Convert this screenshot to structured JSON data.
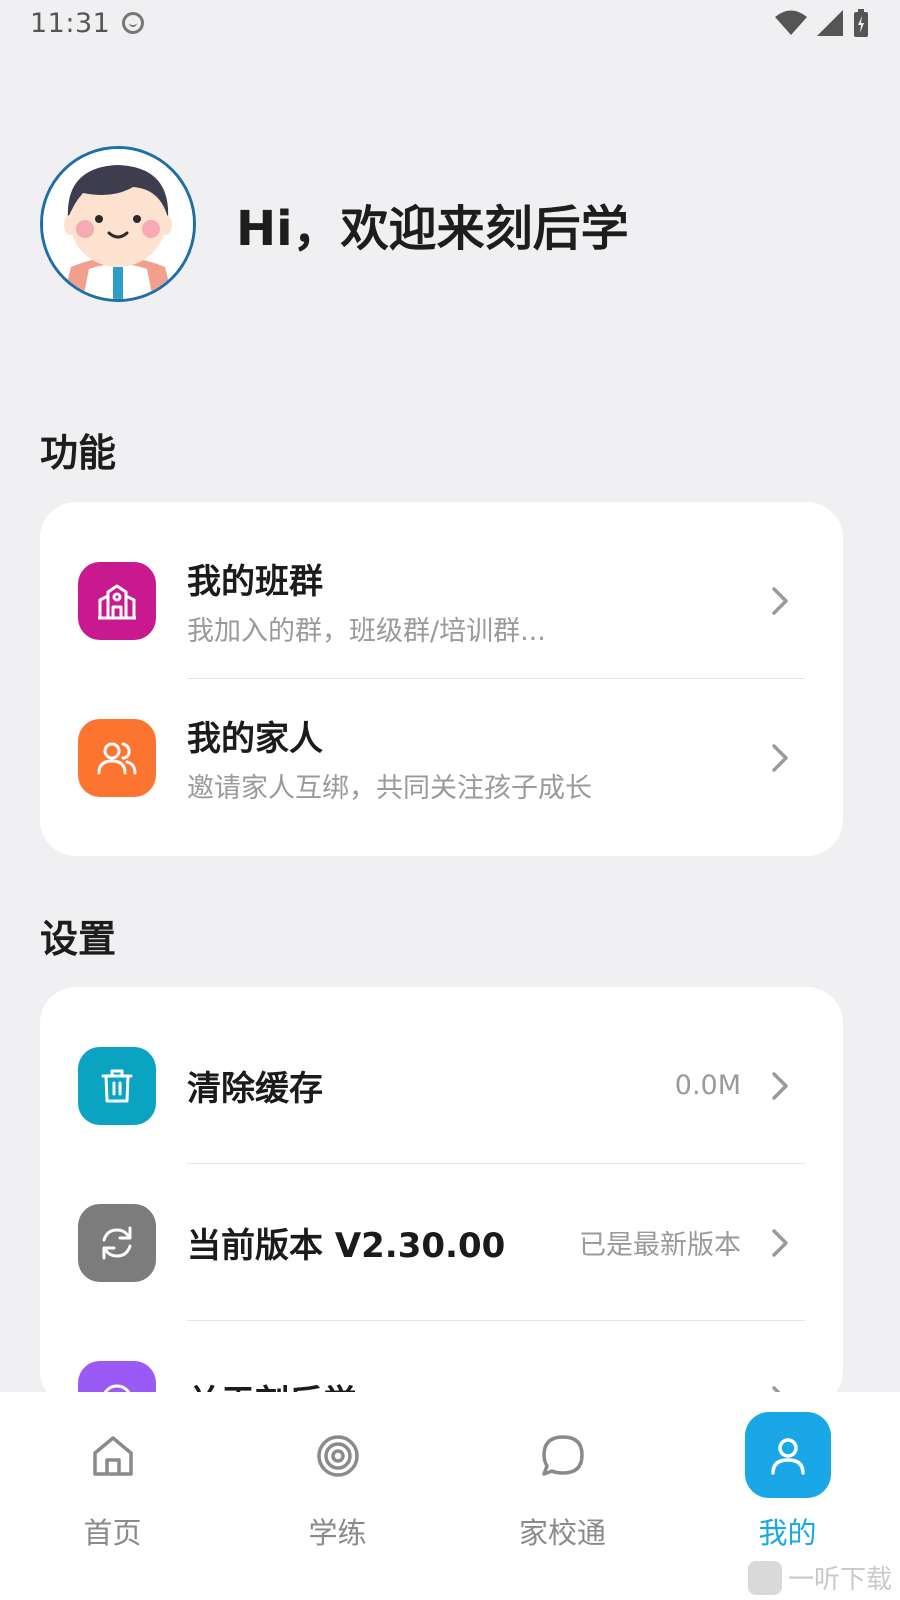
{
  "status_bar": {
    "time": "11:31"
  },
  "profile": {
    "greeting": "Hi，欢迎来刻后学"
  },
  "sections": {
    "features": {
      "title": "功能",
      "items": [
        {
          "title": "我的班群",
          "subtitle": "我加入的群，班级群/培训群...",
          "icon": "school-building-icon",
          "color": "#c8198e"
        },
        {
          "title": "我的家人",
          "subtitle": "邀请家人互绑，共同关注孩子成长",
          "icon": "family-icon",
          "color": "#fb7530"
        }
      ]
    },
    "settings": {
      "title": "设置",
      "items": [
        {
          "title": "清除缓存",
          "value": "0.0M",
          "icon": "trash-icon",
          "color": "#0aa3c2"
        },
        {
          "title": "当前版本 V2.30.00",
          "value": "已是最新版本",
          "icon": "refresh-icon",
          "color": "#7c7c7c"
        },
        {
          "title": "关于刻后学",
          "icon": "about-icon",
          "color": "#9b59f6"
        }
      ]
    }
  },
  "tabbar": {
    "tabs": [
      {
        "label": "首页",
        "icon": "home-icon"
      },
      {
        "label": "学练",
        "icon": "target-icon"
      },
      {
        "label": "家校通",
        "icon": "chat-icon"
      },
      {
        "label": "我的",
        "icon": "user-icon",
        "active": true
      }
    ],
    "accent": "#1aa7e8"
  },
  "watermark": "一听下载"
}
